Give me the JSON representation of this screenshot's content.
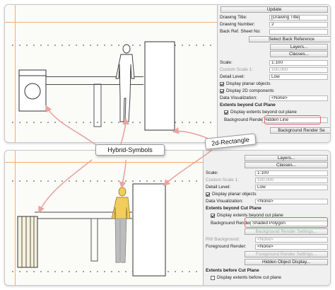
{
  "top_panel": {
    "update_button": "Update",
    "drawing_title_label": "Drawing Title:",
    "drawing_title_value": "[Drawing Title]",
    "drawing_number_label": "Drawing Number:",
    "drawing_number_value": "2",
    "back_ref_label": "Back Ref. Sheet No:",
    "select_back_reference_button": "Select Back Reference",
    "layers_button": "Layers...",
    "classes_button": "Classes...",
    "scale_label": "Scale:",
    "scale_value": "1:100",
    "custom_scale_label": "Custom Scale 1:",
    "custom_scale_value": "100,000",
    "detail_level_label": "Detail Level:",
    "detail_level_value": "Low",
    "display_planar_objects": "Display planar objects",
    "display_2d_components": "Display 2D components",
    "data_visualization_label": "Data Visualization:",
    "data_visualization_value": "<None>",
    "extents_beyond_header": "Extents beyond Cut Plane",
    "display_extents_beyond": "Display extents beyond cut plane",
    "background_render_label": "Background Render:",
    "background_render_value": "Hidden Line",
    "background_render_settings_button": "Background Render Se"
  },
  "bottom_panel": {
    "layers_button": "Layers...",
    "classes_button": "Classes...",
    "scale_label": "Scale:",
    "scale_value": "1:100",
    "custom_scale_label": "Custom Scale 1:",
    "custom_scale_value": "100,000",
    "detail_level_label": "Detail Level:",
    "detail_level_value": "Low",
    "display_planar_objects": "Display planar objects",
    "data_visualization_label": "Data Visualization:",
    "data_visualization_value": "<None>",
    "extents_beyond_header": "Extents beyond Cut Plane",
    "display_extents_beyond": "Display extents beyond cut plane",
    "background_render_label": "Background Render:",
    "background_render_value": "Shaded Polygon",
    "background_render_settings_button": "Background Render Settings...",
    "rw_background_label": "RW Background:",
    "rw_background_value": "<None>",
    "foreground_render_label": "Foreground Render:",
    "foreground_render_value": "<None>",
    "foreground_render_settings_button": "Foreground Render Settings...",
    "hidden_object_display_button": "Hidden Object Display...",
    "extents_before_header": "Extents before Cut Plane",
    "display_extents_before": "Display extents before cut plane"
  },
  "callouts": {
    "hybrid_symbols": "Hybrid-Symbols",
    "rectangle_2d": "2d-Rectangle"
  },
  "colors": {
    "highlight": "#e0646c",
    "arrow": "#e9a4a0",
    "ref_line": "#f0b070",
    "figure_fill": "#f1ce5c"
  },
  "icons": {
    "checkbox": "check-icon"
  }
}
